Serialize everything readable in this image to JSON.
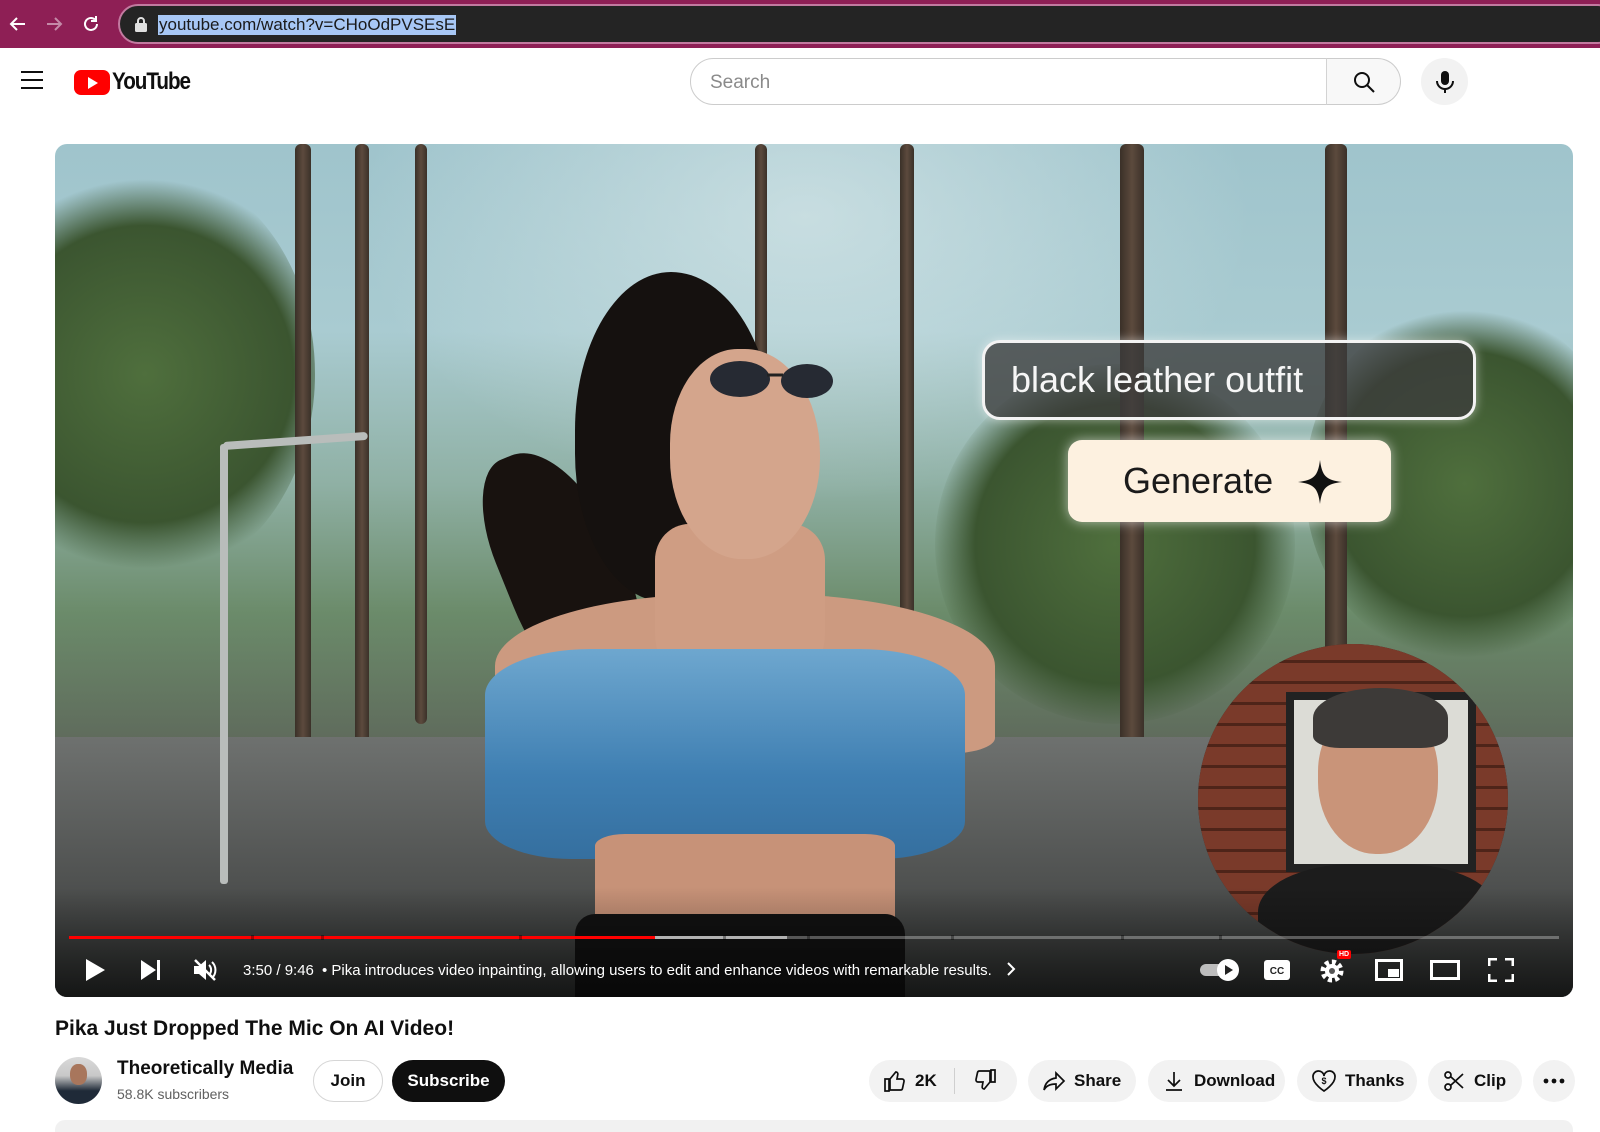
{
  "browser": {
    "url": "youtube.com/watch?v=CHoOdPVSEsE"
  },
  "header": {
    "logo_text": "YouTube",
    "search_placeholder": "Search"
  },
  "video": {
    "overlay_prompt": "black leather outfit",
    "overlay_button": "Generate",
    "time": "3:50 / 9:46",
    "chapter": "• Pika introduces video inpainting, allowing users to edit and enhance videos with remarkable results.",
    "progress_fraction": 0.393,
    "buffered_fraction": 0.482,
    "hd_badge": "HD"
  },
  "info": {
    "title": "Pika Just Dropped The Mic On AI Video!",
    "channel_name": "Theoretically Media",
    "subscribers": "58.8K subscribers",
    "join_label": "Join",
    "subscribe_label": "Subscribe",
    "likes": "2K",
    "share_label": "Share",
    "download_label": "Download",
    "thanks_label": "Thanks",
    "clip_label": "Clip"
  },
  "colors": {
    "browser_bar": "#8e1f55",
    "youtube_red": "#ff0000",
    "progress_red": "#ff0000"
  }
}
